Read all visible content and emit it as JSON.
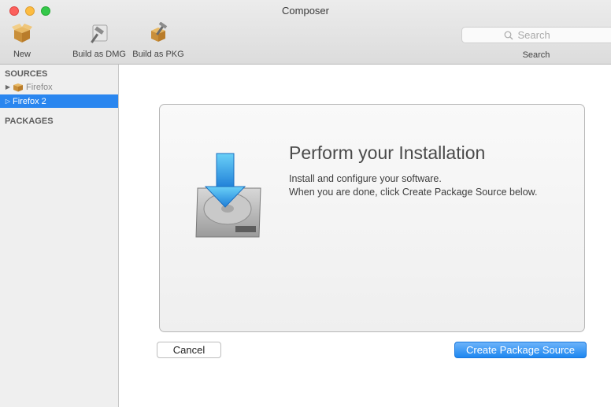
{
  "window": {
    "title": "Composer"
  },
  "toolbar": {
    "items": [
      {
        "label": "New",
        "icon": "open-box-icon"
      },
      {
        "label": "Build as DMG",
        "icon": "hammer-icon"
      },
      {
        "label": "Build as PKG",
        "icon": "package-hammer-icon"
      }
    ],
    "search": {
      "placeholder": "Search",
      "label": "Search"
    }
  },
  "sidebar": {
    "sources_heading": "SOURCES",
    "sources": [
      {
        "label": "Firefox",
        "icon": "package-icon",
        "selected": false
      },
      {
        "label": "Firefox 2",
        "selected": true
      }
    ],
    "packages_heading": "PACKAGES"
  },
  "main": {
    "title": "Perform your Installation",
    "line1": "Install and configure your software.",
    "line2": "When you are done, click Create Package Source below.",
    "icon": "hard-drive-download-icon"
  },
  "buttons": {
    "cancel": "Cancel",
    "create": "Create Package Source"
  },
  "colors": {
    "selection": "#2a86ef",
    "primary_button": "#1e87f0",
    "close": "#fc605c",
    "minimize": "#fdbc40",
    "zoom": "#34c84a"
  }
}
